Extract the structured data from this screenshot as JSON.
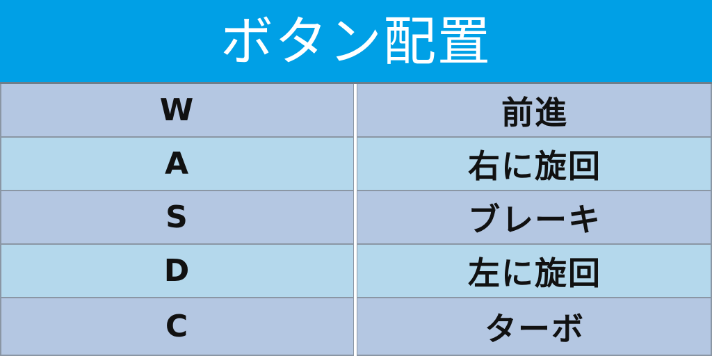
{
  "header": {
    "title": "ボタン配置"
  },
  "rows": [
    {
      "key": "W",
      "action": "前進"
    },
    {
      "key": "A",
      "action": "右に旋回"
    },
    {
      "key": "S",
      "action": "ブレーキ"
    },
    {
      "key": "D",
      "action": "左に旋回"
    },
    {
      "key": "C",
      "action": "ターボ"
    }
  ],
  "colors": {
    "header_bg": "#00a0e6",
    "row_odd": "#b4c7e2",
    "row_even": "#b4d8ec",
    "text": "#111111"
  }
}
